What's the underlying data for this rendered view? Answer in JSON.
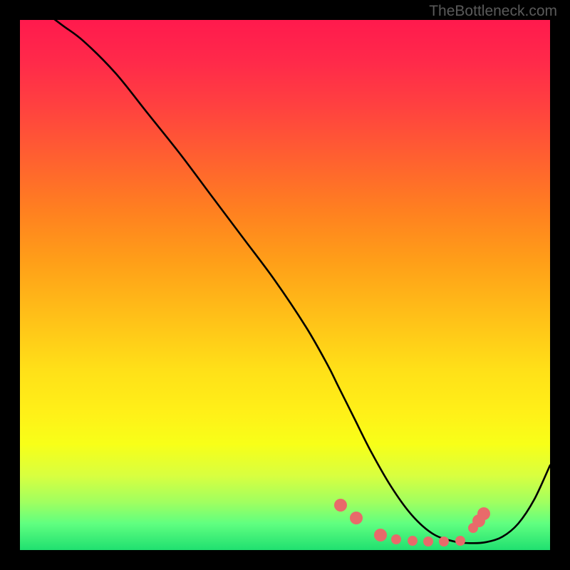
{
  "watermark": "TheBottleneck.com",
  "chart_data": {
    "type": "line",
    "title": "",
    "xlabel": "",
    "ylabel": "",
    "xlim": [
      0,
      100
    ],
    "ylim": [
      0,
      100
    ],
    "series": [
      {
        "name": "curve",
        "x": [
          0,
          4,
          8,
          12,
          18,
          24,
          30,
          36,
          42,
          48,
          54,
          58,
          60,
          63,
          66,
          70,
          74,
          78,
          82,
          85,
          88,
          91,
          94,
          97,
          100
        ],
        "y": [
          105,
          102,
          99,
          96,
          90,
          82.5,
          75,
          67,
          59,
          51,
          42,
          35,
          31,
          25,
          19,
          12,
          6.5,
          3,
          1.6,
          1.3,
          1.5,
          2.5,
          5,
          9.5,
          16
        ]
      }
    ],
    "markers": {
      "name": "highlight-points",
      "x": [
        60.5,
        63.5,
        68,
        71,
        74,
        77,
        80,
        83,
        85.5,
        86.5,
        87.5
      ],
      "y": [
        8.5,
        6.0,
        2.8,
        2.0,
        1.8,
        1.6,
        1.6,
        1.8,
        4.2,
        5.5,
        6.8
      ]
    },
    "gradient_note": "vertical red-to-green heat background"
  }
}
